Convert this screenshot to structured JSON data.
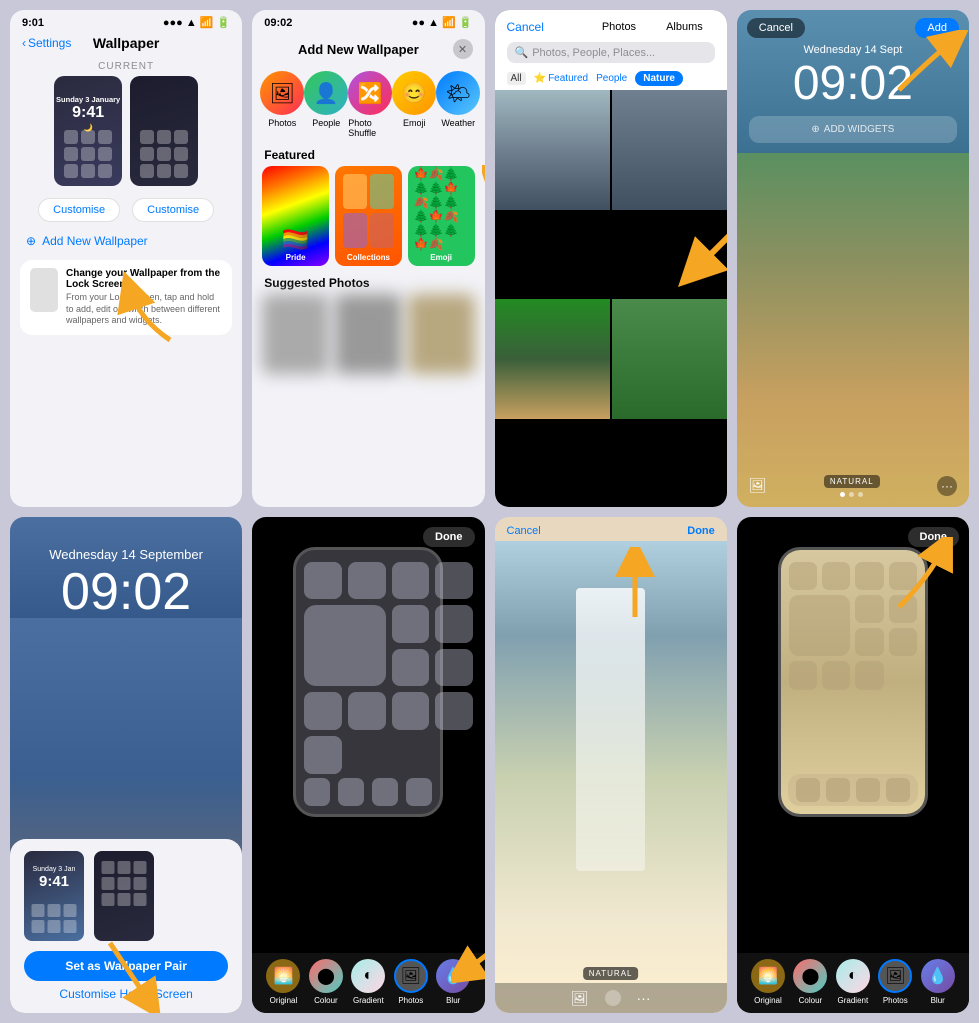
{
  "panels": {
    "p1": {
      "status_time": "9:01",
      "title": "Wallpaper",
      "back_label": "Settings",
      "current_label": "CURRENT",
      "time_display": "9:41",
      "customise_left": "Customise",
      "customise_right": "Customise",
      "add_wallpaper": "Add New Wallpaper",
      "tip_title": "Change your Wallpaper from the Lock Screen",
      "tip_body": "From your Lock Screen, tap and hold to add, edit or switch between different wallpapers and widgets."
    },
    "p2": {
      "status_time": "09:02",
      "modal_title": "Add New Wallpaper",
      "icons": [
        {
          "label": "Photos",
          "emoji": "🖼"
        },
        {
          "label": "People",
          "emoji": "👤"
        },
        {
          "label": "Photo Shuffle",
          "emoji": "🔀"
        },
        {
          "label": "Emoji",
          "emoji": "😊"
        },
        {
          "label": "Weather",
          "emoji": "🌤"
        }
      ],
      "featured_label": "Featured",
      "cards": [
        {
          "label": "Pride"
        },
        {
          "label": "Collections"
        },
        {
          "label": "Emoji"
        }
      ],
      "suggested_label": "Suggested Photos"
    },
    "p3": {
      "cancel": "Cancel",
      "tab_photos": "Photos",
      "tab_albums": "Albums",
      "search_placeholder": "Photos, People, Places...",
      "filter_all": "All",
      "filter_featured": "Featured",
      "filter_people": "People",
      "filter_nature": "Nature"
    },
    "p4": {
      "cancel": "Cancel",
      "add": "Add",
      "date": "Wednesday 14 Sept",
      "time": "09:02",
      "add_widgets": "ADD WIDGETS",
      "natural_label": "NATURAL"
    },
    "p5": {
      "date": "Wednesday 14 September",
      "time": "09:02",
      "set_button": "Set as Wallpaper Pair",
      "customise_home": "Customise Home Screen",
      "mini_time": "9:41"
    },
    "p6": {
      "done": "Done",
      "options": [
        "Original",
        "Colour",
        "Gradient",
        "Photos",
        "Blur"
      ]
    },
    "p7": {
      "cancel": "Cancel",
      "done": "Done",
      "natural_label": "NATURAL"
    },
    "p8": {
      "done": "Done",
      "options": [
        "Original",
        "Colour",
        "Gradient",
        "Photos",
        "Blur"
      ]
    }
  }
}
